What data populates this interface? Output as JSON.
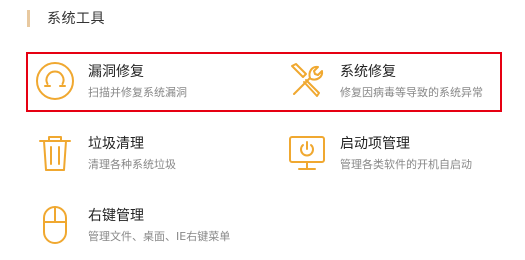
{
  "section": {
    "title": "系统工具"
  },
  "colors": {
    "accent": "#f0a830",
    "highlight": "#e60012",
    "header_bar": "#e8c9a0"
  },
  "tools": [
    {
      "name": "漏洞修复",
      "desc": "扫描并修复系统漏洞",
      "icon": "vulnerability-repair-icon"
    },
    {
      "name": "系统修复",
      "desc": "修复因病毒等导致的系统异常",
      "icon": "tools-wrench-screwdriver-icon"
    },
    {
      "name": "垃圾清理",
      "desc": "清理各种系统垃圾",
      "icon": "trash-can-icon"
    },
    {
      "name": "启动项管理",
      "desc": "管理各类软件的开机自启动",
      "icon": "monitor-power-icon"
    },
    {
      "name": "右键管理",
      "desc": "管理文件、桌面、IE右键菜单",
      "icon": "mouse-icon"
    }
  ]
}
